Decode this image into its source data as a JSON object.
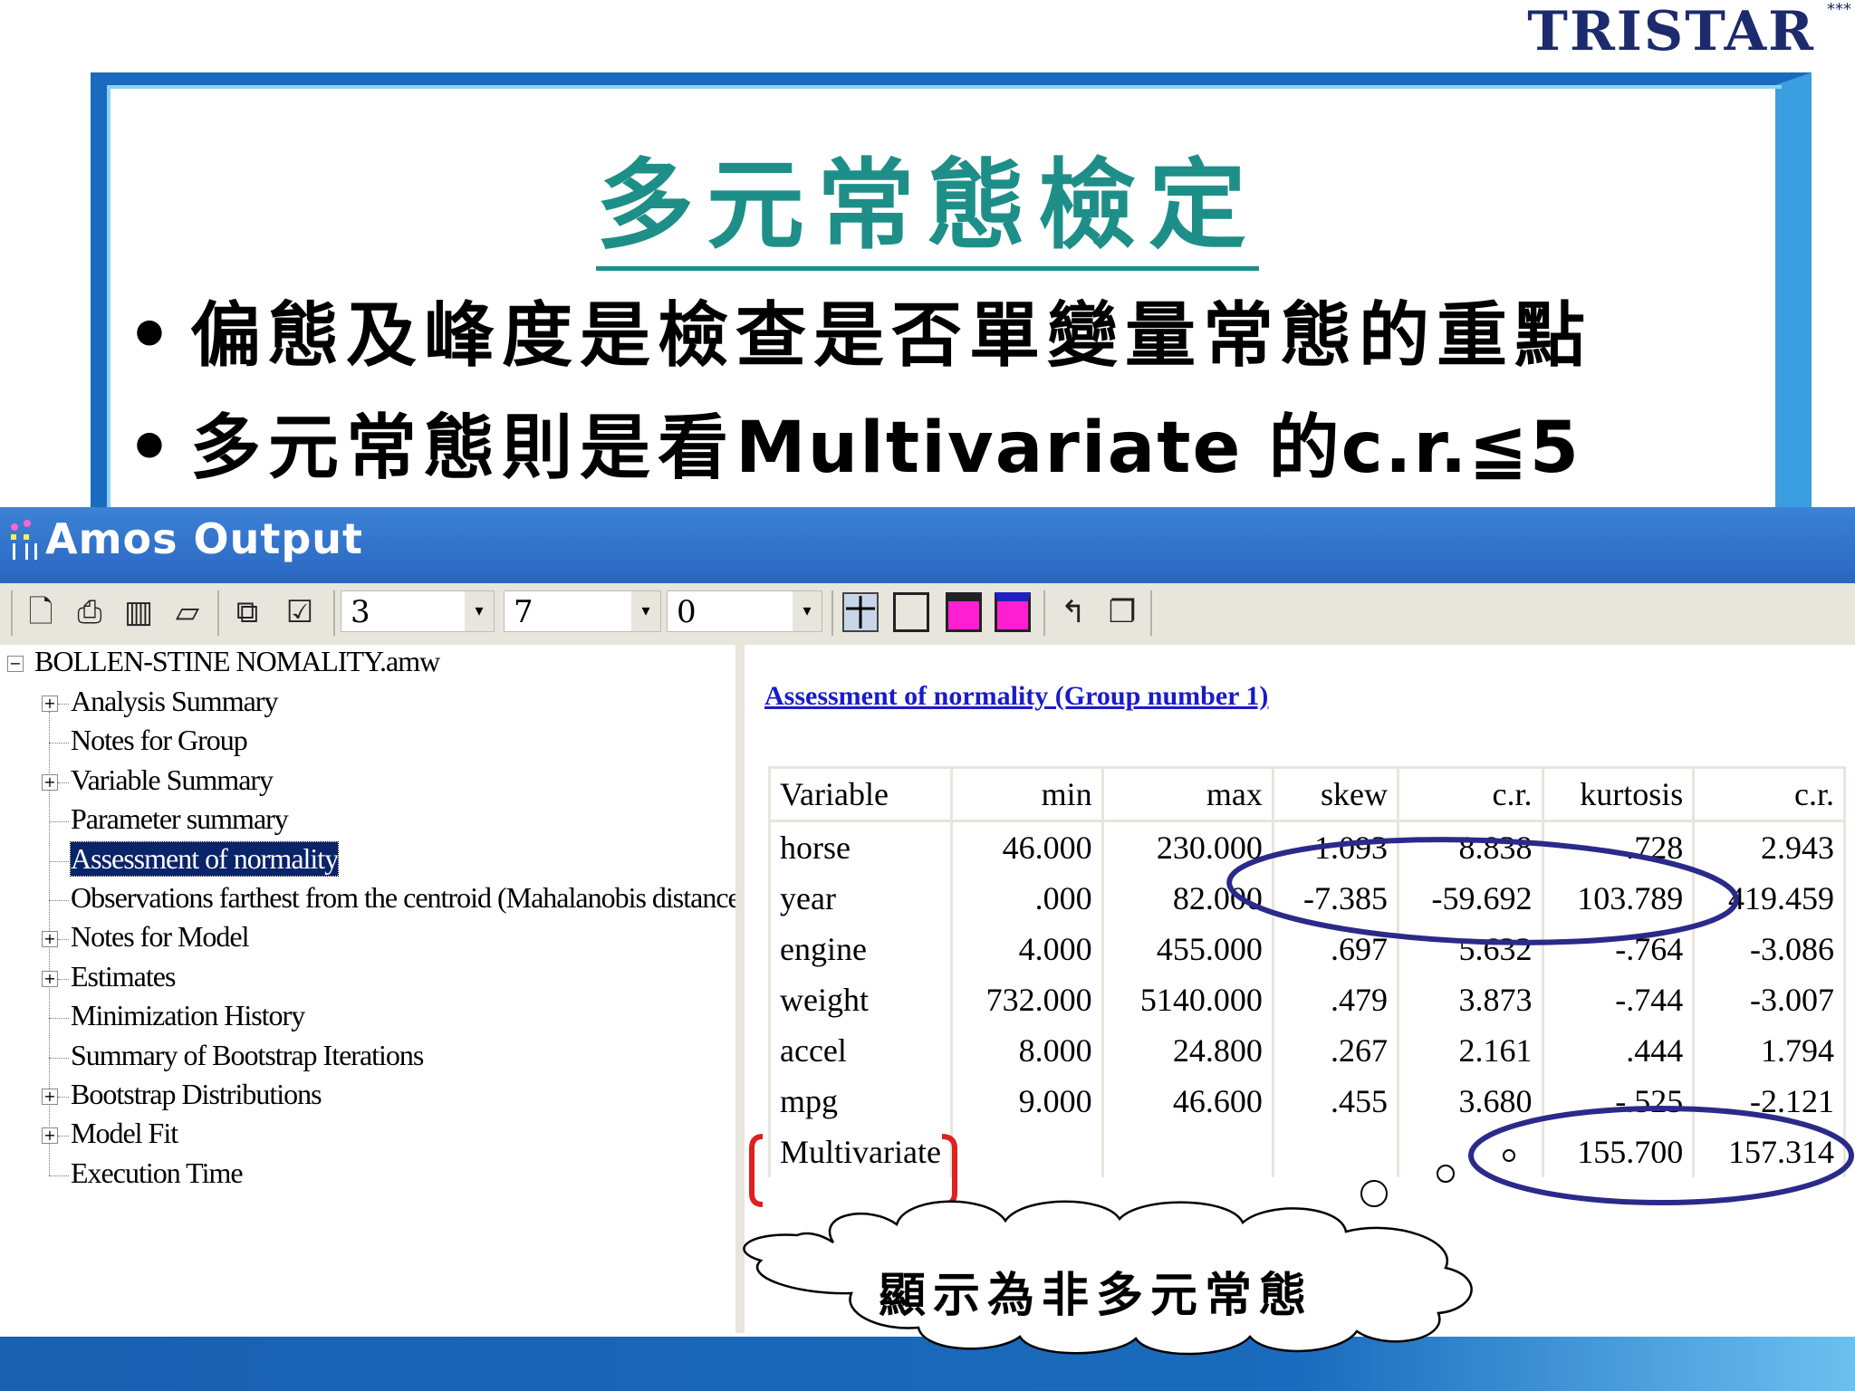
{
  "slide": {
    "logo": "TRISTAR",
    "logo_stars": "***",
    "title": "多元常態檢定",
    "bullets": [
      "偏態及峰度是檢查是否單變量常態的重點",
      {
        "prefix": "多元常態則是看",
        "latin": "Multivariate",
        "suffix": " 的c.r.≦5"
      }
    ],
    "callout": "顯示為非多元常態"
  },
  "window": {
    "title": "Amos Output",
    "toolbar": {
      "icons": [
        "print-preview-icon",
        "print-icon",
        "book-icon",
        "open-folder-icon",
        "copy-icon",
        "checkbox-icon"
      ],
      "combo1": "3",
      "combo2": "7",
      "combo3": "0",
      "combo_arrow": "▾",
      "icons_right": [
        "grid-icon",
        "table-icon",
        "magenta-table-icon",
        "magenta-table-alt-icon",
        "pointer-icon",
        "help-book-icon"
      ]
    }
  },
  "tree": {
    "root": "BOLLEN-STINE NOMALITY.amw",
    "items": [
      {
        "label": "Analysis Summary",
        "expandable": true
      },
      {
        "label": "Notes for Group",
        "expandable": false
      },
      {
        "label": "Variable Summary",
        "expandable": true
      },
      {
        "label": "Parameter summary",
        "expandable": false
      },
      {
        "label": "Assessment of normality",
        "expandable": false,
        "selected": true
      },
      {
        "label": "Observations farthest from the centroid (Mahalanobis distance)",
        "expandable": false
      },
      {
        "label": "Notes for Model",
        "expandable": true
      },
      {
        "label": "Estimates",
        "expandable": true
      },
      {
        "label": "Minimization History",
        "expandable": false
      },
      {
        "label": "Summary of Bootstrap Iterations",
        "expandable": false
      },
      {
        "label": "Bootstrap Distributions",
        "expandable": true
      },
      {
        "label": "Model Fit",
        "expandable": true
      },
      {
        "label": "Execution Time",
        "expandable": false
      }
    ]
  },
  "output": {
    "heading": "Assessment of normality (Group number 1)",
    "columns": [
      "Variable",
      "min",
      "max",
      "skew",
      "c.r.",
      "kurtosis",
      "c.r."
    ],
    "rows": [
      [
        "horse",
        "46.000",
        "230.000",
        "1.093",
        "8.838",
        ".728",
        "2.943"
      ],
      [
        "year",
        ".000",
        "82.000",
        "-7.385",
        "-59.692",
        "103.789",
        "419.459"
      ],
      [
        "engine",
        "4.000",
        "455.000",
        ".697",
        "5.632",
        "-.764",
        "-3.086"
      ],
      [
        "weight",
        "732.000",
        "5140.000",
        ".479",
        "3.873",
        "-.744",
        "-3.007"
      ],
      [
        "accel",
        "8.000",
        "24.800",
        ".267",
        "2.161",
        ".444",
        "1.794"
      ],
      [
        "mpg",
        "9.000",
        "46.600",
        ".455",
        "3.680",
        "-.525",
        "-2.121"
      ],
      [
        "Multivariate",
        "",
        "",
        "",
        "",
        "155.700",
        "157.314"
      ]
    ]
  },
  "colors": {
    "title_teal": "#1e8f88",
    "frame_blue": "#1a6bbd",
    "window_title_blue": "#2a66c0",
    "link_blue": "#1a1acc",
    "ellipse_navy": "#2a2a8a",
    "bracket_red": "#e02020",
    "selection_navy": "#0a246a"
  }
}
